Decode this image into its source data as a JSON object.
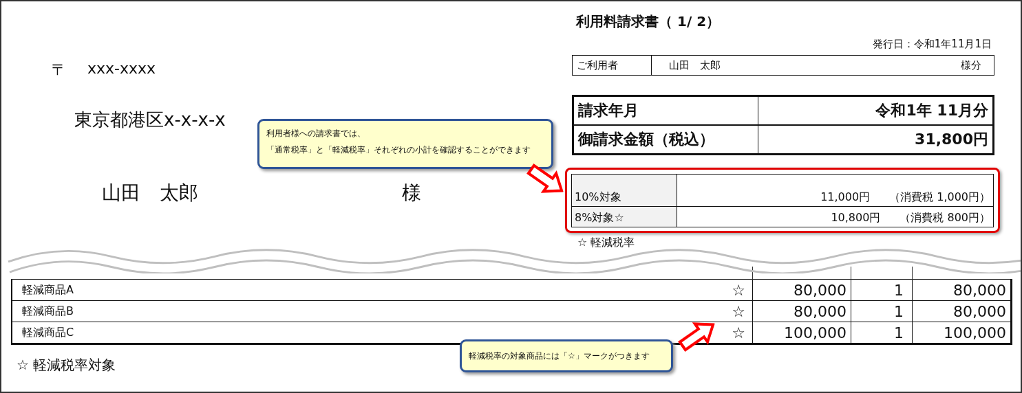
{
  "recipient": {
    "postal_mark": "〒",
    "postal_code": "xxx-xxxx",
    "address": "東京都港区x-x-x-x",
    "name": "山田　太郎",
    "honorific": "様"
  },
  "invoice": {
    "title": "利用料請求書（ 1/ 2）",
    "issue_date": "発行日：令和1年11月1日",
    "user_label": "ご利用者",
    "user_name": "山田　太郎",
    "user_suffix": "様分",
    "billing": [
      {
        "label": "請求年月",
        "value": "令和1年  11月分"
      },
      {
        "label": "御請求金額（税込）",
        "value": "31,800円"
      }
    ],
    "subtotals": [
      {
        "label": "10%対象",
        "amount": "11,000円",
        "tax": "（消費税 1,000円）"
      },
      {
        "label": "8%対象☆",
        "amount": "10,800円",
        "tax": "（消費税 800円）"
      }
    ],
    "subtotal_note": "☆ 軽減税率"
  },
  "items": [
    {
      "name": "軽減商品A",
      "mark": "☆",
      "price": "80,000",
      "quantity": "1",
      "total": "80,000"
    },
    {
      "name": "軽減商品B",
      "mark": "☆",
      "price": "80,000",
      "quantity": "1",
      "total": "80,000"
    },
    {
      "name": "軽減商品C",
      "mark": "☆",
      "price": "100,000",
      "quantity": "1",
      "total": "100,000"
    }
  ],
  "items_note": "☆ 軽減税率対象",
  "callouts": [
    {
      "lines": [
        "利用者様への請求書では、",
        "「通常税率」と「軽減税率」それぞれの小計を確認することができます"
      ]
    },
    {
      "lines": [
        "軽減税率の対象商品には「☆」マークがつきます"
      ]
    }
  ]
}
